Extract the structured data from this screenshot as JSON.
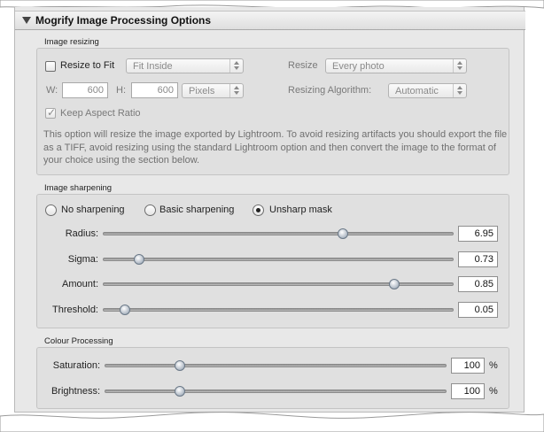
{
  "panel": {
    "title": "Mogrify Image Processing Options"
  },
  "resizing": {
    "section_label": "Image resizing",
    "resize_to_fit": {
      "label": "Resize to Fit",
      "checked": false
    },
    "fit_popup": {
      "selected": "Fit Inside"
    },
    "resize_label": "Resize",
    "resize_popup": {
      "selected": "Every photo"
    },
    "width_label": "W:",
    "width_value": "600",
    "height_label": "H:",
    "height_value": "600",
    "unit_popup": {
      "selected": "Pixels"
    },
    "algorithm_label": "Resizing Algorithm:",
    "algorithm_popup": {
      "selected": "Automatic"
    },
    "keep_aspect": {
      "label": "Keep Aspect Ratio",
      "checked": true
    },
    "description": "This option will resize the image exported by Lightroom. To avoid resizing artifacts you should export the file as a TIFF, avoid resizing using the standard Lightroom option and then convert the image to the format of your choice using the section below."
  },
  "sharpening": {
    "section_label": "Image sharpening",
    "options": [
      {
        "label": "No sharpening",
        "selected": false
      },
      {
        "label": "Basic sharpening",
        "selected": false
      },
      {
        "label": "Unsharp mask",
        "selected": true
      }
    ],
    "sliders": [
      {
        "label": "Radius:",
        "value": "6.95",
        "fraction": 0.69
      },
      {
        "label": "Sigma:",
        "value": "0.73",
        "fraction": 0.09
      },
      {
        "label": "Amount:",
        "value": "0.85",
        "fraction": 0.84
      },
      {
        "label": "Threshold:",
        "value": "0.05",
        "fraction": 0.05
      }
    ]
  },
  "colour": {
    "section_label": "Colour Processing",
    "sliders": [
      {
        "label": "Saturation:",
        "value": "100",
        "unit": "%",
        "fraction": 0.21
      },
      {
        "label": "Brightness:",
        "value": "100",
        "unit": "%",
        "fraction": 0.21
      }
    ]
  },
  "colors": {
    "dialog_bg": "#e8e8e8",
    "group_bg": "#e0e0e0",
    "knob_blue": "#aeb8c4"
  }
}
